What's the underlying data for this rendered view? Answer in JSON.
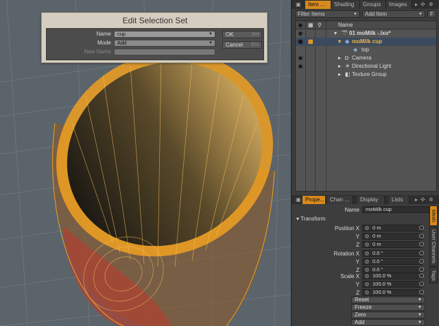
{
  "dialog": {
    "title": "Edit Selection Set",
    "name_label": "Name",
    "name_value": "cup",
    "mode_label": "Mode",
    "mode_value": "Add",
    "new_name_label": "New Name",
    "new_name_value": "",
    "ok_label": "OK",
    "ok_shortcut": "Ret",
    "cancel_label": "Cancel",
    "cancel_shortcut": "Esc"
  },
  "top_tabs": [
    "Item ...",
    "Shading",
    "Groups",
    "Images"
  ],
  "filter_items": "Filter Items",
  "add_item": "Add Item",
  "f_button": "F",
  "list_header": "Name",
  "items": [
    {
      "label": "01 moMilk -.lxo*",
      "indent": 0,
      "visible": true
    },
    {
      "label": "moMilk cup",
      "indent": 1,
      "visible": true
    },
    {
      "label": "top",
      "indent": 2,
      "visible": false
    },
    {
      "label": "Camera",
      "indent": 1,
      "visible": true
    },
    {
      "label": "Directional Light",
      "indent": 1,
      "visible": true
    },
    {
      "label": "Texture Group",
      "indent": 1,
      "visible": false
    }
  ],
  "bottom_tabs": [
    "Prope...",
    "Chan ...",
    "Display",
    "Lists"
  ],
  "properties": {
    "name_label": "Name",
    "name_value": "moMilk cup",
    "transform_header": "Transform",
    "position_label": "Position X",
    "position": [
      "0 m",
      "0 m",
      "0 m"
    ],
    "rotation_label": "Rotation X",
    "rotation": [
      "0.0 °",
      "0.0 °",
      "0.0 °"
    ],
    "scale_label": "Scale X",
    "scale": [
      "100.0 %",
      "100.0 %",
      "100.0 %"
    ],
    "y_label": "Y",
    "z_label": "Z",
    "reset": "Reset",
    "freeze": "Freeze",
    "zero": "Zero",
    "add": "Add"
  },
  "side_tabs": [
    "Mesh",
    "User Channels",
    "Tags"
  ],
  "colors": {
    "accent": "#d88a1c",
    "wire": "#f0a020",
    "selection": "#f0b64a"
  }
}
